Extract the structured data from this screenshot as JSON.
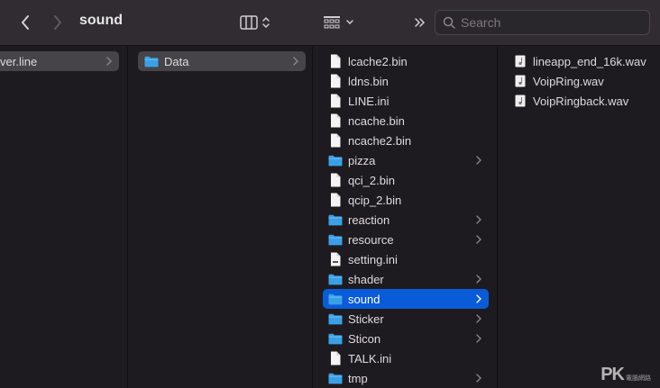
{
  "toolbar": {
    "title": "sound",
    "search_placeholder": "Search"
  },
  "columns": [
    {
      "items": [
        {
          "label": "ver.line",
          "kind": "folder-partial",
          "selected": "grey",
          "has_children": true
        }
      ]
    },
    {
      "items": [
        {
          "label": "Data",
          "kind": "folder",
          "selected": "grey",
          "has_children": true
        }
      ]
    },
    {
      "items": [
        {
          "label": "lcache2.bin",
          "kind": "file"
        },
        {
          "label": "ldns.bin",
          "kind": "file"
        },
        {
          "label": "LINE.ini",
          "kind": "file"
        },
        {
          "label": "ncache.bin",
          "kind": "file"
        },
        {
          "label": "ncache2.bin",
          "kind": "file"
        },
        {
          "label": "pizza",
          "kind": "folder",
          "has_children": true
        },
        {
          "label": "qci_2.bin",
          "kind": "file"
        },
        {
          "label": "qcip_2.bin",
          "kind": "file"
        },
        {
          "label": "reaction",
          "kind": "folder",
          "has_children": true
        },
        {
          "label": "resource",
          "kind": "folder",
          "has_children": true
        },
        {
          "label": "setting.ini",
          "kind": "doc"
        },
        {
          "label": "shader",
          "kind": "folder",
          "has_children": true
        },
        {
          "label": "sound",
          "kind": "folder",
          "selected": "blue",
          "has_children": true
        },
        {
          "label": "Sticker",
          "kind": "folder",
          "has_children": true
        },
        {
          "label": "Sticon",
          "kind": "folder",
          "has_children": true
        },
        {
          "label": "TALK.ini",
          "kind": "file"
        },
        {
          "label": "tmp",
          "kind": "folder",
          "has_children": true
        }
      ]
    },
    {
      "items": [
        {
          "label": "lineapp_end_16k.wav",
          "kind": "audio"
        },
        {
          "label": "VoipRing.wav",
          "kind": "audio"
        },
        {
          "label": "VoipRingback.wav",
          "kind": "audio"
        }
      ]
    }
  ],
  "watermark": {
    "logo": "PK",
    "sub": "電腦網路"
  },
  "colors": {
    "selection_blue": "#0a5bd8",
    "selection_grey": "#464349",
    "folder": "#3aa0e6",
    "background": "#1e1b20",
    "toolbar": "#302c32"
  }
}
